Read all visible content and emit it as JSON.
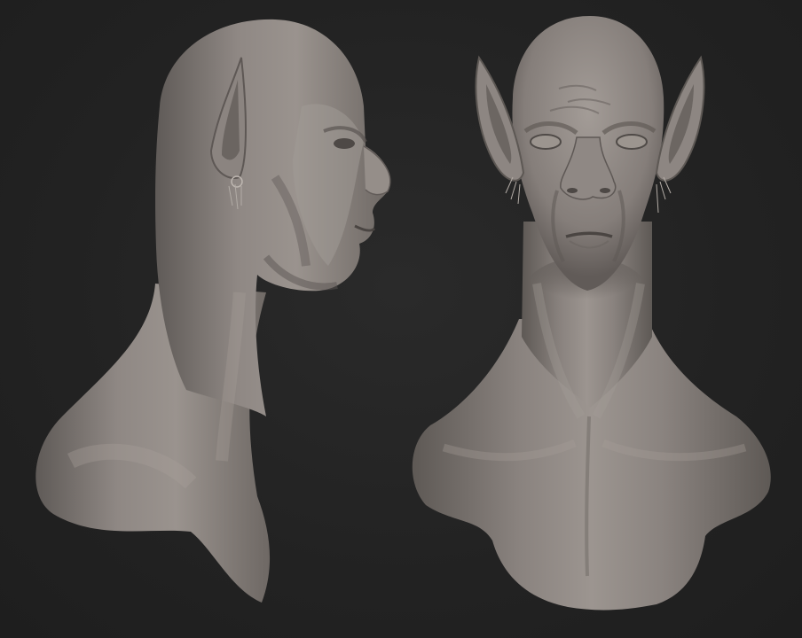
{
  "scene": {
    "background_color": "#232323",
    "material_color": "#8a8480",
    "views": [
      {
        "id": "side",
        "label": ""
      },
      {
        "id": "front",
        "label": ""
      }
    ]
  }
}
